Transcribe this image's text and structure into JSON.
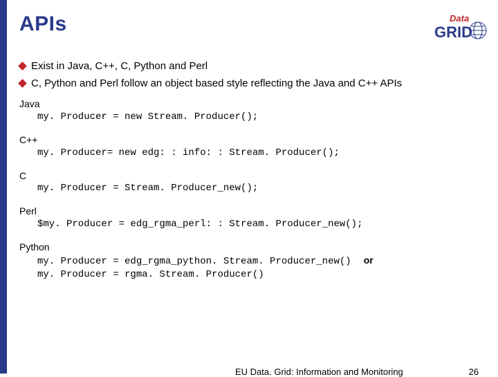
{
  "title": "APIs",
  "logo": {
    "top": "Data",
    "bottom": "GRID"
  },
  "bullets": [
    "Exist in Java, C++, C, Python and Perl",
    "C, Python and Perl follow an object based style reflecting the Java and C++ APIs"
  ],
  "sections": [
    {
      "lang": "Java",
      "code": "my. Producer = new Stream. Producer();"
    },
    {
      "lang": "C++",
      "code": "my. Producer= new edg: : info: : Stream. Producer();"
    },
    {
      "lang": "C",
      "code": "my. Producer = Stream. Producer_new();"
    },
    {
      "lang": "Perl",
      "code": "$my. Producer = edg_rgma_perl: : Stream. Producer_new();"
    },
    {
      "lang": "Python",
      "code": "my. Producer = edg_rgma_python. Stream. Producer_new()",
      "or": "or",
      "code2": "my. Producer = rgma. Stream. Producer()"
    }
  ],
  "footer": "EU Data. Grid: Information and Monitoring",
  "page": "26"
}
